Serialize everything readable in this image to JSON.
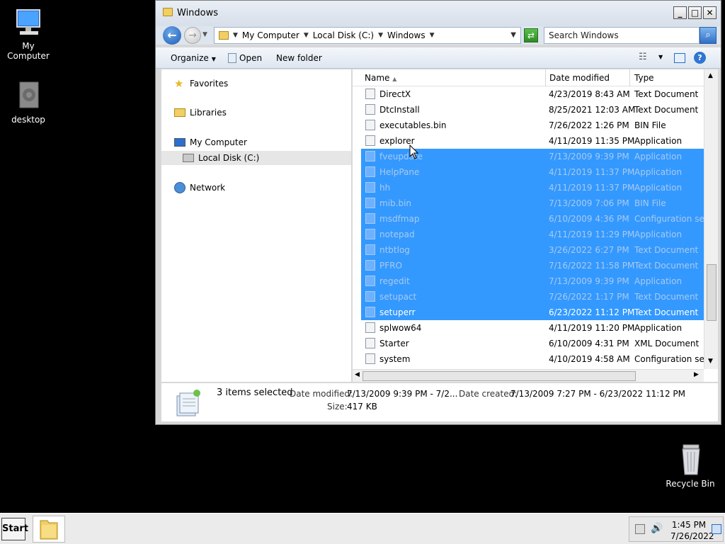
{
  "desktop": {
    "icons": [
      {
        "label": "My Computer"
      },
      {
        "label": "desktop"
      },
      {
        "label": "Recycle Bin"
      }
    ]
  },
  "window": {
    "title": "Windows",
    "controls": {
      "minimize": "_",
      "maximize": "□",
      "close": "✕"
    }
  },
  "nav": {
    "breadcrumbs": [
      "My Computer",
      "Local Disk (C:)",
      "Windows"
    ],
    "search_placeholder": "Search Windows"
  },
  "toolbar": {
    "organize": "Organize",
    "open": "Open",
    "new_folder": "New folder"
  },
  "navpane": {
    "favorites": "Favorites",
    "libraries": "Libraries",
    "my_computer": "My Computer",
    "local_disk": "Local Disk (C:)",
    "network": "Network"
  },
  "columns": {
    "name": "Name",
    "date": "Date modified",
    "type": "Type"
  },
  "files": [
    {
      "name": "DirectX",
      "date": "4/23/2019 8:43 AM",
      "type": "Text Document",
      "selected": false
    },
    {
      "name": "DtcInstall",
      "date": "8/25/2021 12:03 AM",
      "type": "Text Document",
      "selected": false
    },
    {
      "name": "executables.bin",
      "date": "7/26/2022 1:26 PM",
      "type": "BIN File",
      "selected": false
    },
    {
      "name": "explorer",
      "date": "4/11/2019 11:35 PM",
      "type": "Application",
      "selected": false
    },
    {
      "name": "fveupdate",
      "date": "7/13/2009 9:39 PM",
      "type": "Application",
      "selected": true
    },
    {
      "name": "HelpPane",
      "date": "4/11/2019 11:37 PM",
      "type": "Application",
      "selected": true
    },
    {
      "name": "hh",
      "date": "4/11/2019 11:37 PM",
      "type": "Application",
      "selected": true
    },
    {
      "name": "mib.bin",
      "date": "7/13/2009 7:06 PM",
      "type": "BIN File",
      "selected": true
    },
    {
      "name": "msdfmap",
      "date": "6/10/2009 4:36 PM",
      "type": "Configuration sett...",
      "selected": true
    },
    {
      "name": "notepad",
      "date": "4/11/2019 11:29 PM",
      "type": "Application",
      "selected": true
    },
    {
      "name": "ntbtlog",
      "date": "3/26/2022 6:27 PM",
      "type": "Text Document",
      "selected": true
    },
    {
      "name": "PFRO",
      "date": "7/16/2022 11:58 PM",
      "type": "Text Document",
      "selected": true
    },
    {
      "name": "regedit",
      "date": "7/13/2009 9:39 PM",
      "type": "Application",
      "selected": true
    },
    {
      "name": "setupact",
      "date": "7/26/2022 1:17 PM",
      "type": "Text Document",
      "selected": true
    },
    {
      "name": "setuperr",
      "date": "6/23/2022 11:12 PM",
      "type": "Text Document",
      "selected": true
    },
    {
      "name": "splwow64",
      "date": "4/11/2019 11:20 PM",
      "type": "Application",
      "selected": false
    },
    {
      "name": "Starter",
      "date": "6/10/2009 4:31 PM",
      "type": "XML Document",
      "selected": false
    },
    {
      "name": "system",
      "date": "4/10/2019 4:58 AM",
      "type": "Configuration sett...",
      "selected": false
    }
  ],
  "details": {
    "selected": "3 items selected",
    "date_modified_label": "Date modified:",
    "date_modified": "7/13/2009 9:39 PM - 7/2...",
    "date_created_label": "Date created:",
    "date_created": "7/13/2009 7:27 PM - 6/23/2022 11:12 PM",
    "size_label": "Size:",
    "size": "417 KB"
  },
  "taskbar": {
    "start": "Start",
    "time": "1:45 PM",
    "date": "7/26/2022"
  },
  "colors": {
    "selection": "#3399ff",
    "desktop": "#000000"
  }
}
